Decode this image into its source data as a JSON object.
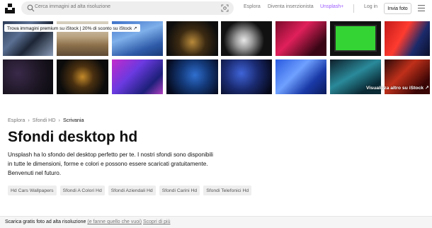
{
  "header": {
    "search_placeholder": "Cerca immagini ad alta risoluzione",
    "nav": {
      "explore": "Esplora",
      "become_contributor": "Diventa inserzionista",
      "unsplash_plus": "Unsplash+",
      "login": "Log in",
      "submit_photo": "Invia foto"
    }
  },
  "gallery": {
    "banner": "Trova immagini premium su iStock | 20% di sconto su iStock ↗",
    "see_more": "Visualizza altro su iStock ↗"
  },
  "breadcrumb": {
    "items": [
      "Esplora",
      "Sfondi HD",
      "Scrivania"
    ],
    "separator": "›"
  },
  "page": {
    "title": "Sfondi desktop hd",
    "description": "Unsplash ha lo sfondo del desktop perfetto per te. I nostri sfondi sono disponibili in tutte le dimensioni, forme e colori e possono essere scaricati gratuitamente. Benvenuti nel futuro."
  },
  "tags": [
    "Hd Cars Wallpapers",
    "Sfondi A Colori Hd",
    "Sfondi Aziendali Hd",
    "Sfondi Carini Hd",
    "Sfondi Telefonici Hd"
  ],
  "footer": {
    "text": "Scarica gratis foto ad alta risoluzione",
    "paren_link": "(e fanne quello che vuoi)",
    "more_link": "Scopri di più"
  },
  "colors": {
    "plus": "#9b59ff",
    "muted": "#767676",
    "tag_bg": "#eeeeee"
  }
}
